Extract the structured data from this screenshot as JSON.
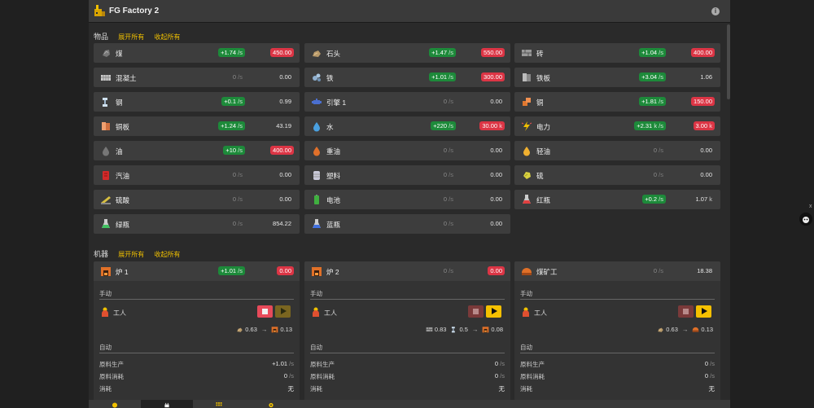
{
  "app": {
    "title": "FG Factory 2",
    "info_icon": "info-icon"
  },
  "items_section": {
    "title": "物品",
    "expand": "展开所有",
    "collapse": "收起所有"
  },
  "items": [
    {
      "name": "煤",
      "icon": "coal-icon",
      "rate": "+1.74",
      "rate_unit": "/s",
      "rate_color": "green",
      "amount": "450.00",
      "amount_unit": "",
      "amount_color": "red"
    },
    {
      "name": "石头",
      "icon": "stone-icon",
      "rate": "+1.47",
      "rate_unit": "/s",
      "rate_color": "green",
      "amount": "550.00",
      "amount_unit": "",
      "amount_color": "red"
    },
    {
      "name": "砖",
      "icon": "brick-icon",
      "rate": "+1.04",
      "rate_unit": "/s",
      "rate_color": "green",
      "amount": "400.00",
      "amount_unit": "",
      "amount_color": "red"
    },
    {
      "name": "混凝土",
      "icon": "concrete-icon",
      "rate": "0",
      "rate_unit": "/s",
      "rate_color": "none",
      "amount": "0.00",
      "amount_unit": "",
      "amount_color": "none"
    },
    {
      "name": "铁",
      "icon": "iron-ore-icon",
      "rate": "+1.01",
      "rate_unit": "/s",
      "rate_color": "green",
      "amount": "300.00",
      "amount_unit": "",
      "amount_color": "red"
    },
    {
      "name": "铁板",
      "icon": "iron-plate-icon",
      "rate": "+3.04",
      "rate_unit": "/s",
      "rate_color": "green",
      "amount": "1.06",
      "amount_unit": "",
      "amount_color": "none"
    },
    {
      "name": "钢",
      "icon": "steel-icon",
      "rate": "+0.1",
      "rate_unit": "/s",
      "rate_color": "green",
      "amount": "0.99",
      "amount_unit": "",
      "amount_color": "none"
    },
    {
      "name": "引擎 1",
      "icon": "engine-icon",
      "rate": "0",
      "rate_unit": "/s",
      "rate_color": "none",
      "amount": "0.00",
      "amount_unit": "",
      "amount_color": "none"
    },
    {
      "name": "铜",
      "icon": "copper-ore-icon",
      "rate": "+1.81",
      "rate_unit": "/s",
      "rate_color": "green",
      "amount": "150.00",
      "amount_unit": "",
      "amount_color": "red"
    },
    {
      "name": "铜板",
      "icon": "copper-plate-icon",
      "rate": "+1.24",
      "rate_unit": "/s",
      "rate_color": "green",
      "amount": "43.19",
      "amount_unit": "",
      "amount_color": "none"
    },
    {
      "name": "水",
      "icon": "water-icon",
      "rate": "+220",
      "rate_unit": "/s",
      "rate_color": "green",
      "amount": "30.00",
      "amount_unit": "k",
      "amount_color": "red"
    },
    {
      "name": "电力",
      "icon": "power-icon",
      "rate": "+2.31",
      "rate_unit": "k /s",
      "rate_color": "green",
      "amount": "3.00",
      "amount_unit": "k",
      "amount_color": "red"
    },
    {
      "name": "油",
      "icon": "oil-icon",
      "rate": "+10",
      "rate_unit": "/s",
      "rate_color": "green",
      "amount": "400.00",
      "amount_unit": "",
      "amount_color": "red"
    },
    {
      "name": "重油",
      "icon": "heavy-oil-icon",
      "rate": "0",
      "rate_unit": "/s",
      "rate_color": "none",
      "amount": "0.00",
      "amount_unit": "",
      "amount_color": "none"
    },
    {
      "name": "轻油",
      "icon": "light-oil-icon",
      "rate": "0",
      "rate_unit": "/s",
      "rate_color": "none",
      "amount": "0.00",
      "amount_unit": "",
      "amount_color": "none"
    },
    {
      "name": "汽油",
      "icon": "gasoline-icon",
      "rate": "0",
      "rate_unit": "/s",
      "rate_color": "none",
      "amount": "0.00",
      "amount_unit": "",
      "amount_color": "none"
    },
    {
      "name": "塑料",
      "icon": "plastic-icon",
      "rate": "0",
      "rate_unit": "/s",
      "rate_color": "none",
      "amount": "0.00",
      "amount_unit": "",
      "amount_color": "none"
    },
    {
      "name": "硫",
      "icon": "sulfur-icon",
      "rate": "0",
      "rate_unit": "/s",
      "rate_color": "none",
      "amount": "0.00",
      "amount_unit": "",
      "amount_color": "none"
    },
    {
      "name": "硫酸",
      "icon": "sulfuric-acid-icon",
      "rate": "0",
      "rate_unit": "/s",
      "rate_color": "none",
      "amount": "0.00",
      "amount_unit": "",
      "amount_color": "none"
    },
    {
      "name": "电池",
      "icon": "battery-icon",
      "rate": "0",
      "rate_unit": "/s",
      "rate_color": "none",
      "amount": "0.00",
      "amount_unit": "",
      "amount_color": "none"
    },
    {
      "name": "红瓶",
      "icon": "red-flask-icon",
      "rate": "+0.2",
      "rate_unit": "/s",
      "rate_color": "green",
      "amount": "1.07",
      "amount_unit": "k",
      "amount_color": "none"
    },
    {
      "name": "绿瓶",
      "icon": "green-flask-icon",
      "rate": "0",
      "rate_unit": "/s",
      "rate_color": "none",
      "amount": "854.22",
      "amount_unit": "",
      "amount_color": "none"
    },
    {
      "name": "蓝瓶",
      "icon": "blue-flask-icon",
      "rate": "0",
      "rate_unit": "/s",
      "rate_color": "none",
      "amount": "0.00",
      "amount_unit": "",
      "amount_color": "none"
    }
  ],
  "machines_section": {
    "title": "机器",
    "expand": "展开所有",
    "collapse": "收起所有"
  },
  "machines": [
    {
      "name": "炉 1",
      "icon": "furnace-icon",
      "rate": "+1.01",
      "rate_unit": "/s",
      "rate_color": "green",
      "amount": "0.00",
      "amount_color": "red",
      "manual_label": "手动",
      "worker_label": "工人",
      "worker_icon": "worker-icon",
      "stop_enabled": true,
      "play_enabled": false,
      "recipe": [
        {
          "icon": "stone-icon",
          "value": "0.63"
        }
      ],
      "recipe_output": {
        "icon": "furnace-icon",
        "value": "0.13"
      },
      "auto_label": "自动",
      "stats": [
        {
          "label": "原料生产",
          "value": "+1.01",
          "unit": "/s"
        },
        {
          "label": "原料消耗",
          "value": "0",
          "unit": "/s"
        },
        {
          "label": "消耗",
          "value": "无",
          "unit": ""
        }
      ]
    },
    {
      "name": "炉 2",
      "icon": "furnace-icon",
      "rate": "0",
      "rate_unit": "/s",
      "rate_color": "none",
      "amount": "0.00",
      "amount_color": "red",
      "manual_label": "手动",
      "worker_label": "工人",
      "worker_icon": "worker-icon",
      "stop_enabled": false,
      "play_enabled": true,
      "recipe": [
        {
          "icon": "brick-icon",
          "value": "0.83"
        },
        {
          "icon": "steel-icon",
          "value": "0.5"
        }
      ],
      "recipe_output": {
        "icon": "furnace-icon",
        "value": "0.08"
      },
      "auto_label": "自动",
      "stats": [
        {
          "label": "原料生产",
          "value": "0",
          "unit": "/s"
        },
        {
          "label": "原料消耗",
          "value": "0",
          "unit": "/s"
        },
        {
          "label": "消耗",
          "value": "无",
          "unit": ""
        }
      ]
    },
    {
      "name": "煤矿工",
      "icon": "coal-miner-icon",
      "rate": "0",
      "rate_unit": "/s",
      "rate_color": "none",
      "amount": "18.38",
      "amount_color": "none",
      "manual_label": "手动",
      "worker_label": "工人",
      "worker_icon": "worker-icon",
      "stop_enabled": false,
      "play_enabled": true,
      "recipe": [
        {
          "icon": "stone-icon",
          "value": "0.63"
        }
      ],
      "recipe_output": {
        "icon": "coal-miner-icon",
        "value": "0.13"
      },
      "auto_label": "自动",
      "stats": [
        {
          "label": "原料生产",
          "value": "0",
          "unit": "/s"
        },
        {
          "label": "原料消耗",
          "value": "0",
          "unit": "/s"
        },
        {
          "label": "消耗",
          "value": "无",
          "unit": ""
        }
      ]
    }
  ],
  "bottom_nav": [
    {
      "icon": "coin-icon",
      "active": false
    },
    {
      "icon": "factory-icon",
      "active": true
    },
    {
      "icon": "grid-icon",
      "active": false
    },
    {
      "icon": "gear-icon",
      "active": false
    }
  ],
  "colors": {
    "green": "#1d8a3a",
    "red": "#dc3545",
    "yellow": "#f0c000",
    "card": "#3d3d3d"
  }
}
